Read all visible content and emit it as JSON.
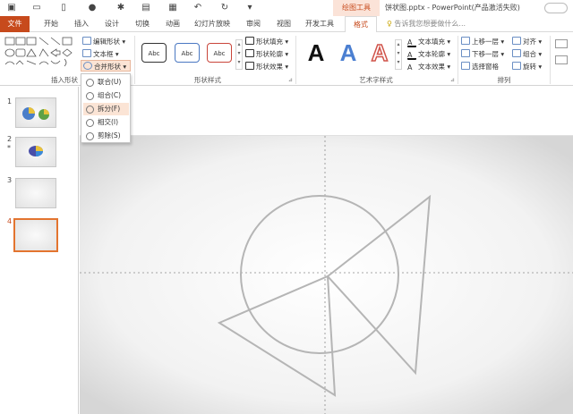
{
  "window": {
    "context_tab_group": "绘图工具",
    "title": "饼状图.pptx - PowerPoint(产品激活失败)"
  },
  "tabs": [
    {
      "label": "文件"
    },
    {
      "label": "开始"
    },
    {
      "label": "插入"
    },
    {
      "label": "设计"
    },
    {
      "label": "切换"
    },
    {
      "label": "动画"
    },
    {
      "label": "幻灯片放映"
    },
    {
      "label": "审阅"
    },
    {
      "label": "视图"
    },
    {
      "label": "开发工具"
    },
    {
      "label": "格式"
    }
  ],
  "search": {
    "placeholder": "告诉我您想要做什么..."
  },
  "ribbon": {
    "insert_shapes": {
      "label": "插入形状",
      "edit_shape": "编辑形状",
      "text_box": "文本框",
      "merge_shapes": "合并形状"
    },
    "shape_styles": {
      "label": "形状样式",
      "sample": "Abc",
      "fill": "形状填充",
      "outline": "形状轮廓",
      "effects": "形状效果"
    },
    "wordart_styles": {
      "label": "艺术字样式",
      "sample": "A",
      "text_fill": "文本填充",
      "text_outline": "文本轮廓",
      "text_effects": "文本效果"
    },
    "arrange": {
      "label": "排列",
      "bring_forward": "上移一层",
      "send_backward": "下移一层",
      "selection_pane": "选择窗格",
      "align": "对齐",
      "group": "组合",
      "rotate": "旋转"
    }
  },
  "merge_menu": {
    "items": [
      {
        "label": "联合(U)"
      },
      {
        "label": "组合(C)"
      },
      {
        "label": "拆分(F)"
      },
      {
        "label": "相交(I)"
      },
      {
        "label": "剪除(S)"
      }
    ],
    "highlighted_index": 2
  },
  "slides": [
    {
      "number": "1",
      "marker": ""
    },
    {
      "number": "2",
      "marker": "*"
    },
    {
      "number": "3",
      "marker": ""
    },
    {
      "number": "4",
      "marker": ""
    }
  ],
  "selected_slide": "4",
  "colors": {
    "accent": "#c74a1c",
    "context_tab_bg": "#fbe3d8",
    "menu_highlight": "#fbe4d5",
    "shape_outline": "#b5b5b5",
    "guide": "#8a8a8a"
  }
}
